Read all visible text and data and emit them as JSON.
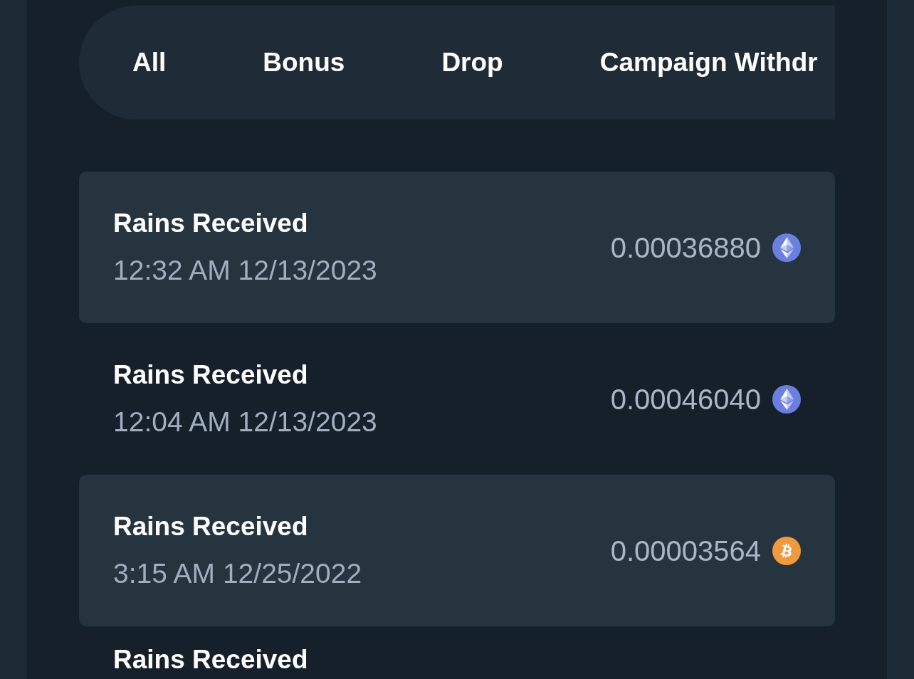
{
  "tabs": [
    "All",
    "Bonus",
    "Drop",
    "Campaign Withdr"
  ],
  "transactions": [
    {
      "kind": "eth",
      "title": "Rains Received",
      "time": "12:32 AM 12/13/2023",
      "amount": "0.00036880"
    },
    {
      "kind": "eth",
      "title": "Rains Received",
      "time": "12:04 AM 12/13/2023",
      "amount": "0.00046040"
    },
    {
      "kind": "btc",
      "title": "Rains Received",
      "time": "3:15 AM 12/25/2022",
      "amount": "0.00003564"
    },
    {
      "title": "Rains Received"
    }
  ]
}
